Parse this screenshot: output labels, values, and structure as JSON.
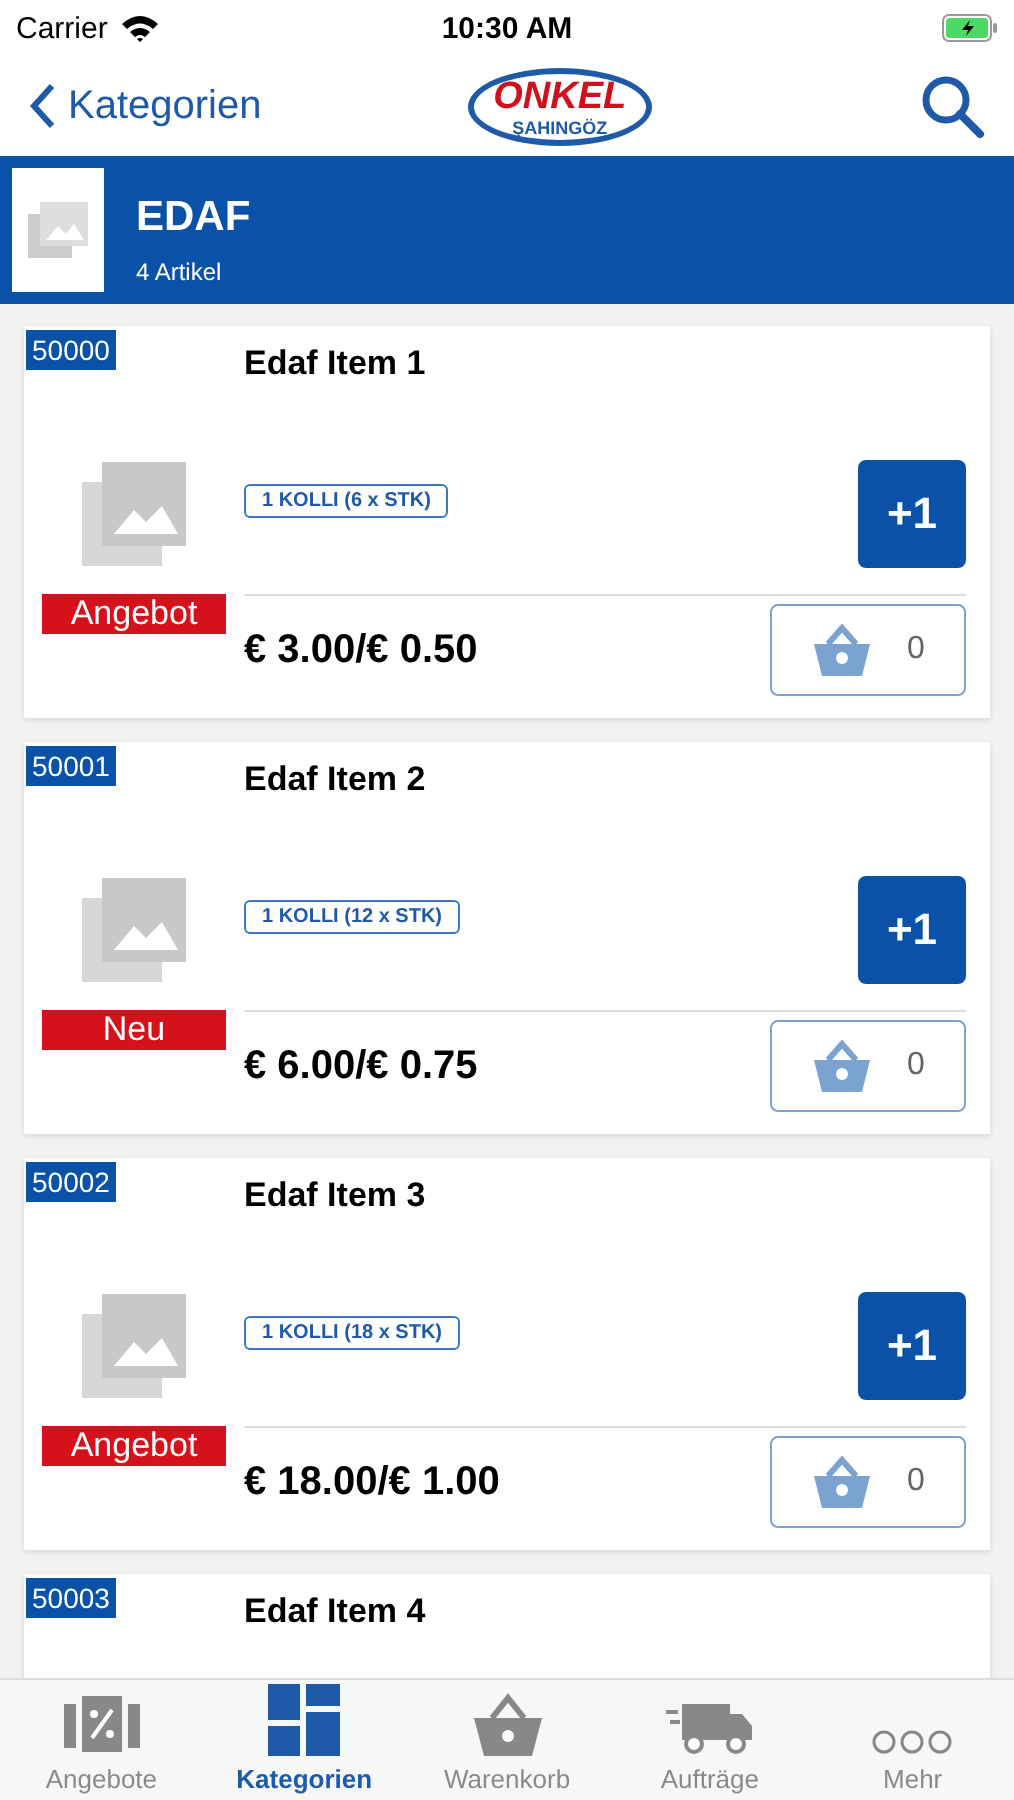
{
  "status_bar": {
    "carrier": "Carrier",
    "time": "10:30 AM"
  },
  "nav_bar": {
    "back_label": "Kategorien",
    "logo_top": "ONKEL",
    "logo_bottom": "ŞAHINGÖZ"
  },
  "category": {
    "title": "EDAF",
    "count": "4 Artikel"
  },
  "items": [
    {
      "code": "50000",
      "name": "Edaf Item 1",
      "pack": "1 KOLLI (6 x STK)",
      "tag": "Angebot",
      "price": "€ 3.00/€ 0.50",
      "add_label": "+1",
      "quantity": "0"
    },
    {
      "code": "50001",
      "name": "Edaf Item 2",
      "pack": "1 KOLLI (12 x STK)",
      "tag": "Neu",
      "price": "€ 6.00/€ 0.75",
      "add_label": "+1",
      "quantity": "0"
    },
    {
      "code": "50002",
      "name": "Edaf Item 3",
      "pack": "1 KOLLI (18 x STK)",
      "tag": "Angebot",
      "price": "€ 18.00/€ 1.00",
      "add_label": "+1",
      "quantity": "0"
    },
    {
      "code": "50003",
      "name": "Edaf Item 4"
    }
  ],
  "tab_bar": [
    {
      "kind": "offers",
      "label": "Angebote",
      "selected": false
    },
    {
      "kind": "categories",
      "label": "Kategorien",
      "selected": true
    },
    {
      "kind": "cart",
      "label": "Warenkorb",
      "selected": false
    },
    {
      "kind": "orders",
      "label": "Aufträge",
      "selected": false
    },
    {
      "kind": "more",
      "label": "Mehr",
      "selected": false
    }
  ]
}
